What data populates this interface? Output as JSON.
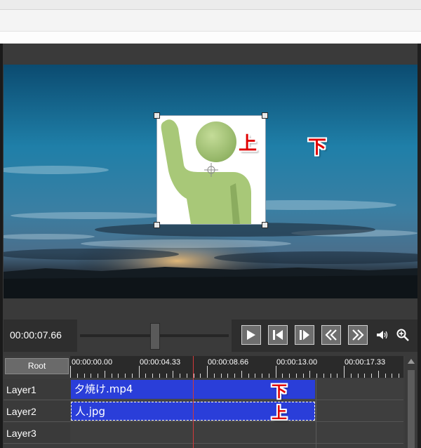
{
  "preview": {
    "overlay_marks": {
      "upper": "上",
      "lower": "下"
    }
  },
  "transport": {
    "time": "00:00:07.66",
    "seek_position_fraction": 0.5,
    "buttons": [
      {
        "name": "play-button",
        "icon": "play-icon"
      },
      {
        "name": "prev-frame-button",
        "icon": "step-back-icon"
      },
      {
        "name": "next-frame-button",
        "icon": "step-forward-icon"
      },
      {
        "name": "rewind-button",
        "icon": "double-chevron-left-icon"
      },
      {
        "name": "fast-forward-button",
        "icon": "double-chevron-right-icon"
      }
    ],
    "volume_icon": "speaker-icon",
    "zoom_icon": "zoom-in-icon"
  },
  "timeline": {
    "root_label": "Root",
    "ruler": [
      "00:00:00.00",
      "00:00:04.33",
      "00:00:08.66",
      "00:00:13.00",
      "00:00:17.33"
    ],
    "layers": [
      {
        "name": "Layer1",
        "clip": "夕焼け.mp4",
        "mark": "下"
      },
      {
        "name": "Layer2",
        "clip": "人.jpg",
        "mark": "上"
      },
      {
        "name": "Layer3",
        "clip": "",
        "mark": ""
      }
    ]
  },
  "colors": {
    "clip_blue": "#2a3ed9",
    "playhead_red": "#d23a3a",
    "annotation_red": "#e00000",
    "figure_green": "#a8c878"
  }
}
